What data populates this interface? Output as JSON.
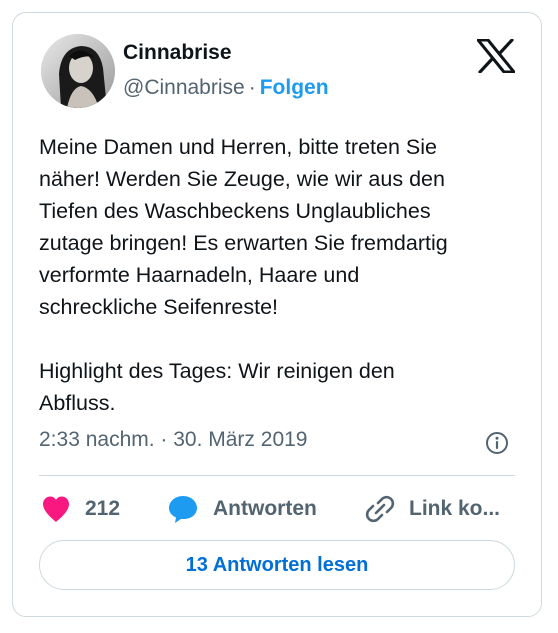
{
  "author": {
    "name": "Cinnabrise",
    "handle": "@Cinnabrise",
    "separator": "·",
    "follow_label": "Folgen"
  },
  "brand": {
    "logo_icon": "x-logo-icon"
  },
  "tweet": {
    "text": "Meine Damen und Herren, bitte treten Sie\nnäher! Werden Sie Zeuge, wie wir aus den\nTiefen des Waschbeckens Unglaubliches\nzutage bringen! Es erwarten Sie fremdartig\nverformte Haarnadeln, Haare und\nschreckliche Seifenreste!\n\nHighlight des Tages: Wir reinigen den\nAbfluss.",
    "timestamp": "2:33 nachm. · 30. März 2019"
  },
  "actions": {
    "like_count": "212",
    "reply_label": "Antworten",
    "link_label": "Link ko..."
  },
  "read_replies_label": "13 Antworten lesen",
  "colors": {
    "accent": "#1d9bf0",
    "like": "#f91880",
    "muted": "#536471",
    "text": "#0f1419",
    "border": "#cfd9de"
  }
}
